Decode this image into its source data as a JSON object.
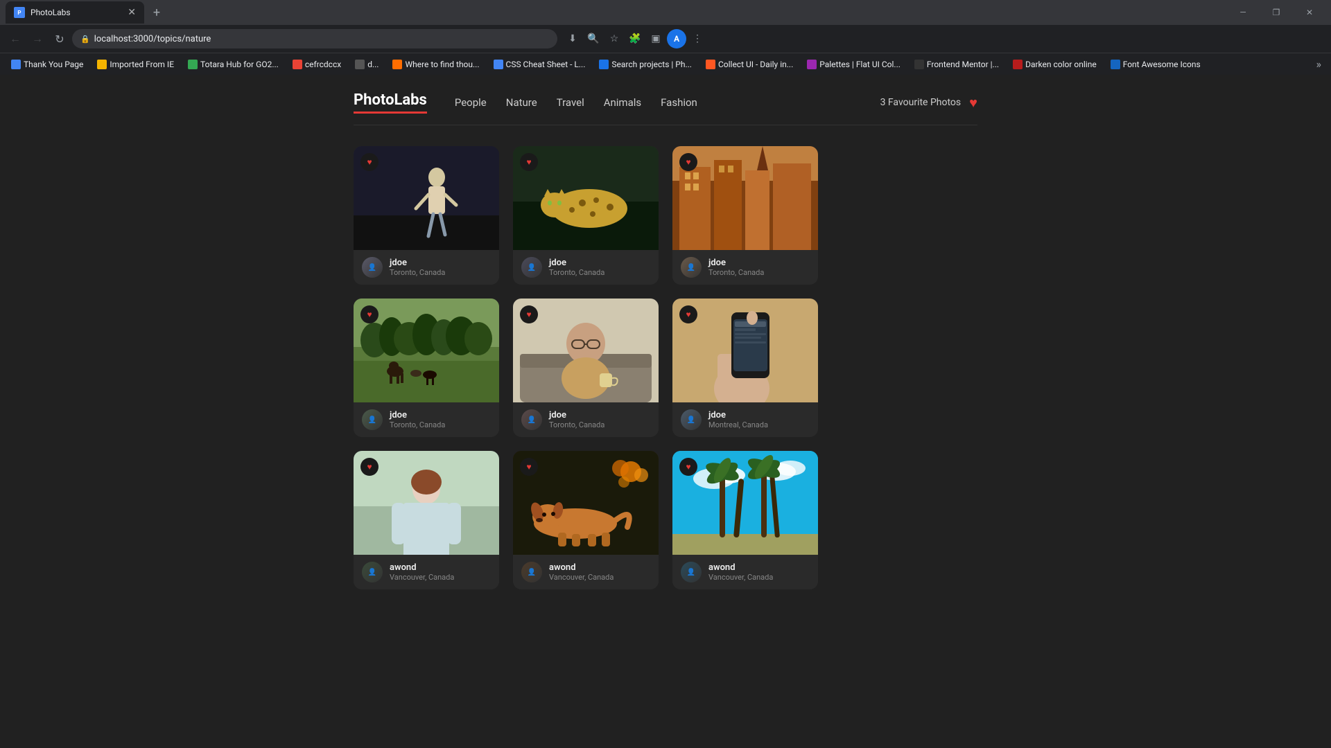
{
  "browser": {
    "tab_title": "PhotoLabs",
    "tab_favicon": "P",
    "url": "localhost:3000/topics/nature",
    "new_tab_label": "+",
    "window_controls": {
      "minimize": "—",
      "maximize": "□",
      "close": "✕"
    },
    "nav": {
      "back": "←",
      "forward": "→",
      "reload": "↺",
      "lock": "🔒"
    },
    "toolbar": {
      "download": "⬇",
      "zoom": "🔍",
      "bookmark_star": "☆",
      "extensions": "🧩",
      "sidebar": "▣",
      "profile": "A",
      "menu": "⋮"
    },
    "bookmarks": [
      {
        "label": "Thank You Page",
        "color": "#4285f4"
      },
      {
        "label": "Imported From IE",
        "color": "#f4b400"
      },
      {
        "label": "Totara Hub for GO2...",
        "color": "#34a853"
      },
      {
        "label": "cefrcdccx",
        "color": "#ea4335"
      },
      {
        "label": "d...",
        "color": "#555"
      },
      {
        "label": "Where to find thou...",
        "color": "#ff6d00"
      },
      {
        "label": "CSS Cheat Sheet - L...",
        "color": "#4285f4"
      },
      {
        "label": "Search projects | Ph...",
        "color": "#1a73e8"
      },
      {
        "label": "Collect UI - Daily in...",
        "color": "#ff5722"
      },
      {
        "label": "Palettes | Flat UI Col...",
        "color": "#9c27b0"
      },
      {
        "label": "Frontend Mentor |...",
        "color": "#333"
      },
      {
        "label": "Darken color online",
        "color": "#b71c1c"
      },
      {
        "label": "Font Awesome Icons",
        "color": "#1565c0"
      }
    ]
  },
  "site": {
    "logo": "PhotoLabs",
    "nav_links": [
      {
        "label": "People",
        "id": "people"
      },
      {
        "label": "Nature",
        "id": "nature"
      },
      {
        "label": "Travel",
        "id": "travel"
      },
      {
        "label": "Animals",
        "id": "animals"
      },
      {
        "label": "Fashion",
        "id": "fashion"
      }
    ],
    "favourites": {
      "count_text": "3 Favourite Photos",
      "heart": "♥"
    }
  },
  "photos": [
    {
      "id": 1,
      "img_class": "img-1",
      "username": "jdoe",
      "location": "Toronto, Canada",
      "liked": true
    },
    {
      "id": 2,
      "img_class": "img-2",
      "username": "jdoe",
      "location": "Toronto, Canada",
      "liked": true
    },
    {
      "id": 3,
      "img_class": "img-3",
      "username": "jdoe",
      "location": "Toronto, Canada",
      "liked": true
    },
    {
      "id": 4,
      "img_class": "img-4",
      "username": "jdoe",
      "location": "Toronto, Canada",
      "liked": true
    },
    {
      "id": 5,
      "img_class": "img-5",
      "username": "jdoe",
      "location": "Toronto, Canada",
      "liked": true
    },
    {
      "id": 6,
      "img_class": "img-6",
      "username": "jdoe",
      "location": "Montreal, Canada",
      "liked": true
    },
    {
      "id": 7,
      "img_class": "img-7",
      "username": "awond",
      "location": "Vancouver, Canada",
      "liked": true
    },
    {
      "id": 8,
      "img_class": "img-8",
      "username": "awond",
      "location": "Vancouver, Canada",
      "liked": true
    },
    {
      "id": 9,
      "img_class": "img-9",
      "username": "awond",
      "location": "Vancouver, Canada",
      "liked": true
    }
  ]
}
